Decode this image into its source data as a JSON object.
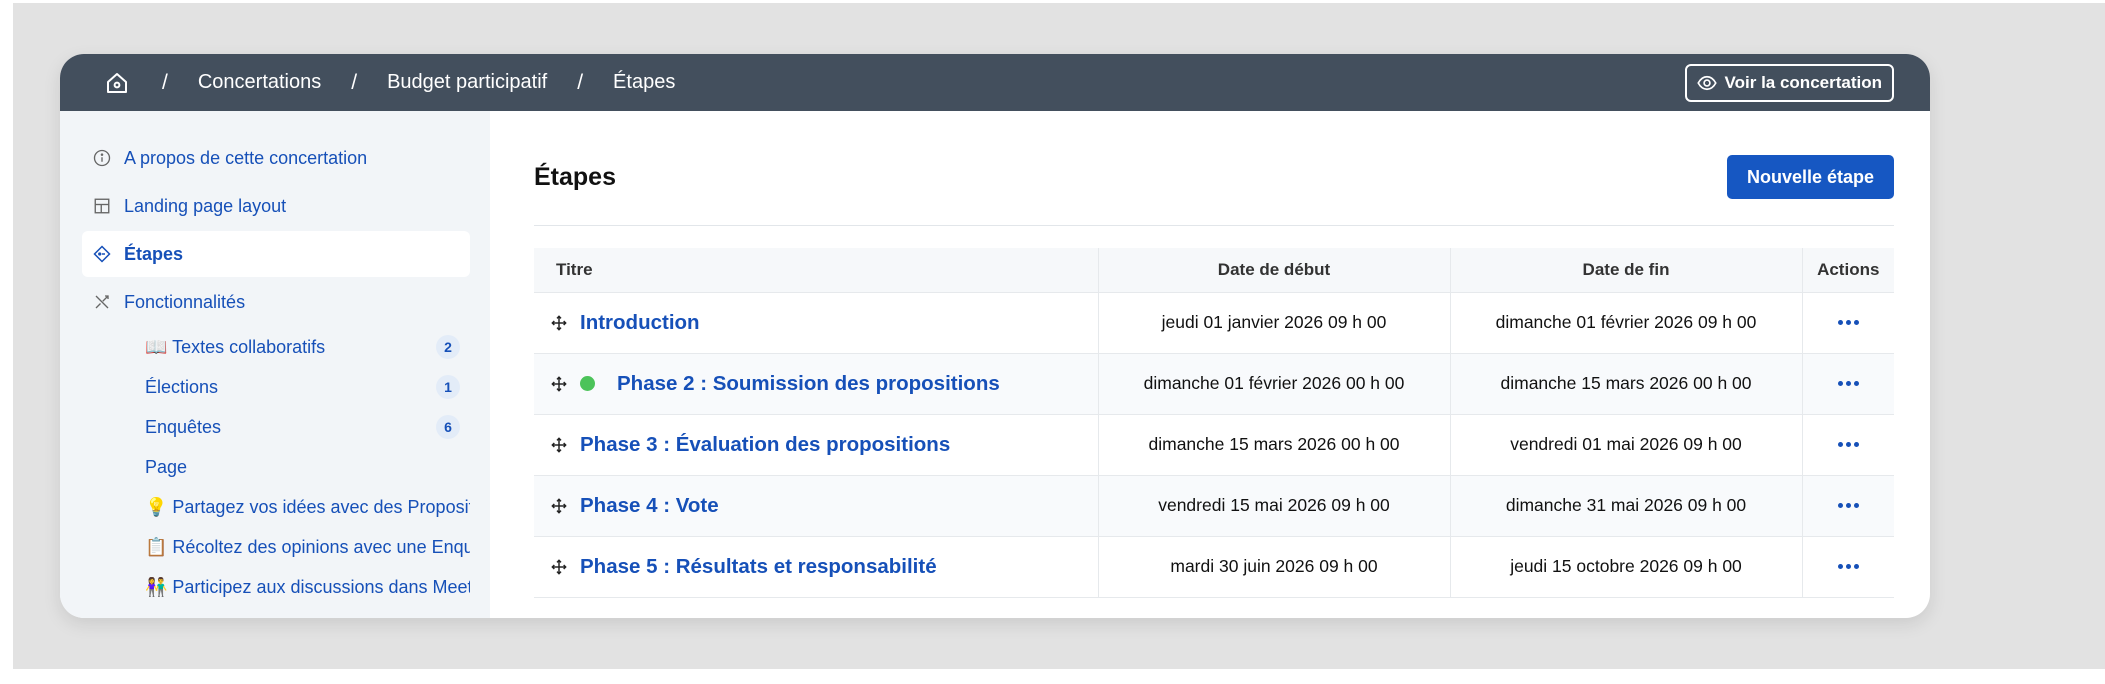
{
  "breadcrumb": {
    "home_icon": "home-icon",
    "items": [
      "Concertations",
      "Budget participatif",
      "Étapes"
    ],
    "separator": "/"
  },
  "header": {
    "view_button_label": "Voir la concertation",
    "view_button_icon": "eye-icon"
  },
  "sidebar": {
    "items": [
      {
        "label": "A propos de cette concertation",
        "icon": "info-circle-icon"
      },
      {
        "label": "Landing page layout",
        "icon": "layout-grid-icon"
      },
      {
        "label": "Étapes",
        "icon": "phase-diamond-icon",
        "active": true
      },
      {
        "label": "Fonctionnalités",
        "icon": "tools-icon"
      }
    ],
    "components": [
      {
        "label": "📖 Textes collaboratifs",
        "count": "2"
      },
      {
        "label": "Élections",
        "count": "1"
      },
      {
        "label": "Enquêtes",
        "count": "6"
      },
      {
        "label": "Page"
      },
      {
        "label": "💡 Partagez vos idées avec des Propositions"
      },
      {
        "label": "📋 Récoltez des opinions avec une Enquête"
      },
      {
        "label": "👫 Participez aux discussions dans Meetings"
      }
    ]
  },
  "main": {
    "title": "Étapes",
    "new_button_label": "Nouvelle étape",
    "columns": {
      "title": "Titre",
      "start": "Date de début",
      "end": "Date de fin",
      "actions": "Actions"
    },
    "rows": [
      {
        "title": "Introduction",
        "start": "jeudi 01 janvier 2026 09 h 00",
        "end": "dimanche 01 février 2026 09 h 00"
      },
      {
        "title": "Phase 2 : Soumission des propositions",
        "start": "dimanche 01 février 2026 00 h 00",
        "end": "dimanche 15 mars 2026 00 h 00",
        "active": true
      },
      {
        "title": "Phase 3 : Évaluation des propositions",
        "start": "dimanche 15 mars 2026 00 h 00",
        "end": "vendredi 01 mai 2026 09 h 00"
      },
      {
        "title": "Phase 4 : Vote",
        "start": "vendredi 15 mai 2026 09 h 00",
        "end": "dimanche 31 mai 2026 09 h 00"
      },
      {
        "title": "Phase 5 : Résultats et responsabilité",
        "start": "mardi 30 juin 2026 09 h 00",
        "end": "jeudi 15 octobre 2026 09 h 00"
      }
    ]
  },
  "colors": {
    "topbar": "#434f5d",
    "link": "#1650b8",
    "primary_button": "#1657c2",
    "active_dot": "#4cc35a",
    "sidebar_bg": "#f2f5f8"
  }
}
